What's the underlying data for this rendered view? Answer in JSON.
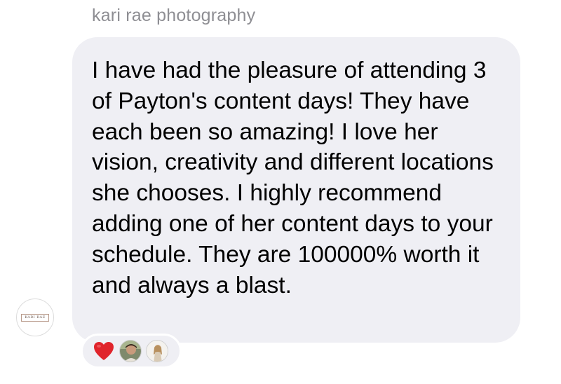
{
  "message": {
    "sender_name": "kari rae photography",
    "text": "I have had the pleasure of attending 3 of Payton's content days! They have each been so amazing! I love her vision, creativity and different locations she chooses. I highly recommend adding one of her content days to your schedule. They are 100000% worth it and always a blast.",
    "avatar_logo_text": "KARI RAE"
  },
  "reactions": {
    "emoji": "heart-icon",
    "heart_color": "#e0242b",
    "reactors": [
      "reactor-avatar-1",
      "reactor-avatar-2"
    ]
  },
  "colors": {
    "bubble": "#efeff4",
    "sender_name": "#8e8e93",
    "text": "#000000"
  }
}
